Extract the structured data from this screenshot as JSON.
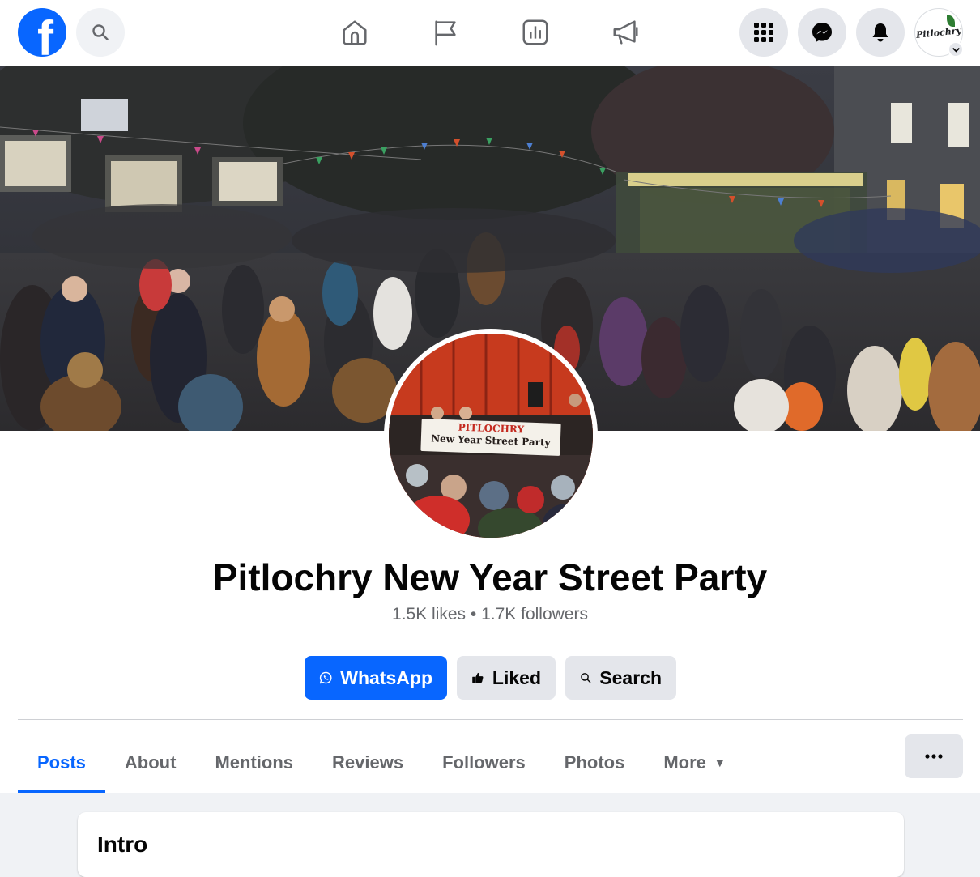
{
  "topbar": {
    "logo": "facebook-logo",
    "profile_avatar_text": "Pitlochry",
    "icons": [
      "search-icon",
      "home-icon",
      "flag-icon",
      "insights-icon",
      "megaphone-icon",
      "menu-grid-icon",
      "messenger-icon",
      "bell-icon",
      "chevron-down-icon"
    ]
  },
  "cover": {
    "description_icon": "cover-photo"
  },
  "profile_picture": {
    "banner_line1": "PITLOCHRY",
    "banner_line2": "New Year Street Party"
  },
  "page": {
    "title": "Pitlochry New Year Street Party",
    "stats": "1.5K likes • 1.7K followers"
  },
  "actions": {
    "whatsapp": "WhatsApp",
    "liked": "Liked",
    "search": "Search"
  },
  "tabs": [
    {
      "label": "Posts",
      "active": true
    },
    {
      "label": "About"
    },
    {
      "label": "Mentions"
    },
    {
      "label": "Reviews"
    },
    {
      "label": "Followers"
    },
    {
      "label": "Photos"
    },
    {
      "label": "More"
    }
  ],
  "intro": {
    "title": "Intro"
  },
  "colors": {
    "accent": "#0866ff",
    "secondary_bg": "#e4e6eb",
    "muted_text": "#65676b"
  }
}
